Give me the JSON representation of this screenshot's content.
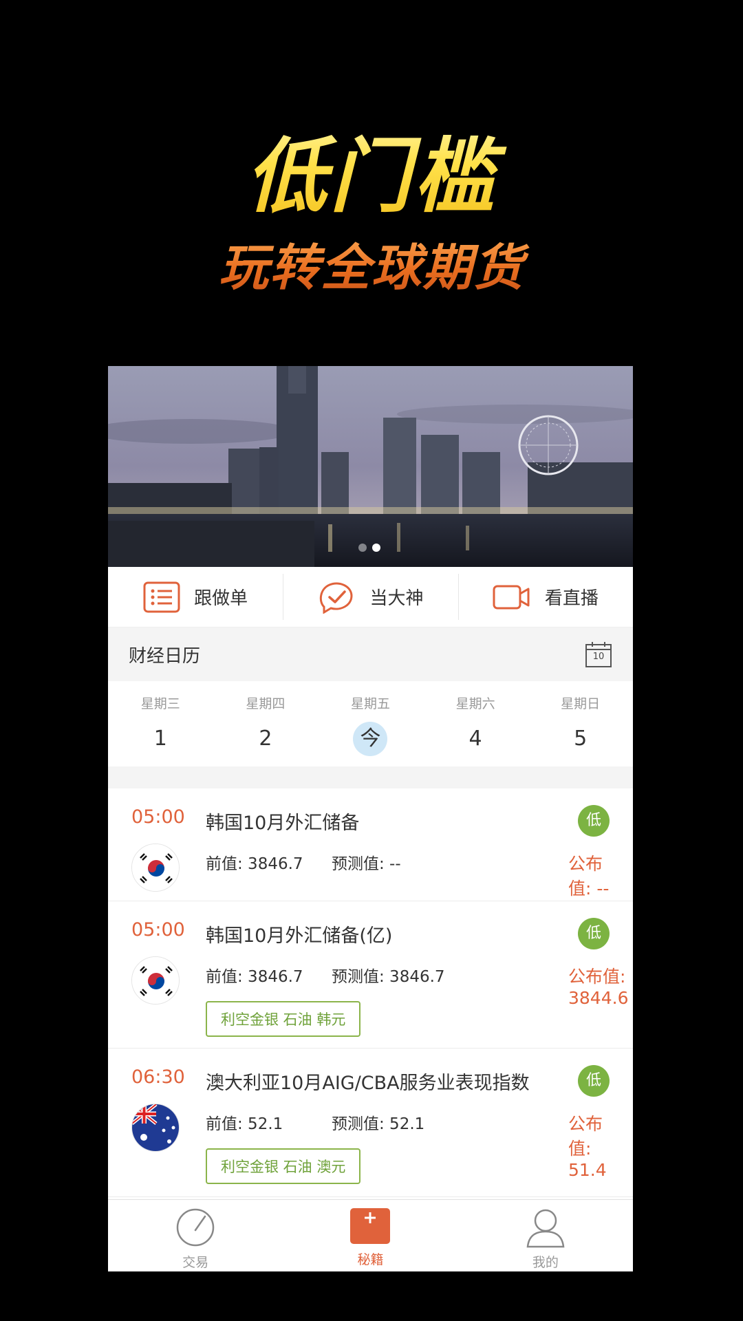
{
  "promo": {
    "headline": "低门槛",
    "subheadline": "玩转全球期货"
  },
  "banner": {
    "dots_total": 2,
    "active_dot": 2
  },
  "quick_actions": [
    {
      "label": "跟做单",
      "icon": "list-icon"
    },
    {
      "label": "当大神",
      "icon": "check-badge-icon"
    },
    {
      "label": "看直播",
      "icon": "video-camera-icon"
    }
  ],
  "calendar": {
    "title": "财经日历",
    "icon_day": "10",
    "days": [
      {
        "name": "星期三",
        "num": "1",
        "today": false
      },
      {
        "name": "星期四",
        "num": "2",
        "today": false
      },
      {
        "name": "星期五",
        "num": "今",
        "today": true
      },
      {
        "name": "星期六",
        "num": "4",
        "today": false
      },
      {
        "name": "星期日",
        "num": "5",
        "today": false
      }
    ]
  },
  "events": [
    {
      "time": "05:00",
      "title": "韩国10月外汇储备",
      "flag": "south-korea-flag-icon",
      "level": "低",
      "prev": "前值: 3846.7",
      "forecast": "预测值: --",
      "published": "公布值: --",
      "tag": ""
    },
    {
      "time": "05:00",
      "title": "韩国10月外汇储备(亿)",
      "flag": "south-korea-flag-icon",
      "level": "低",
      "prev": "前值: 3846.7",
      "forecast": "预测值: 3846.7",
      "published": "公布值: 3844.6",
      "tag": "利空金银 石油 韩元"
    },
    {
      "time": "06:30",
      "title": "澳大利亚10月AIG/CBA服务业表现指数",
      "flag": "australia-flag-icon",
      "level": "低",
      "prev": "前值: 52.1",
      "forecast": "预测值: 52.1",
      "published": "公布值: 51.4",
      "tag": "利空金银 石油 澳元"
    }
  ],
  "tabbar": [
    {
      "label": "交易",
      "icon": "gauge-icon",
      "active": false
    },
    {
      "label": "秘籍",
      "icon": "book-plus-icon",
      "active": true
    },
    {
      "label": "我的",
      "icon": "user-icon",
      "active": false
    }
  ],
  "colors": {
    "accent": "#e0623b",
    "level_low": "#7cb342",
    "tag_green": "#6fa23a",
    "today_bg": "#cfe7f7"
  }
}
